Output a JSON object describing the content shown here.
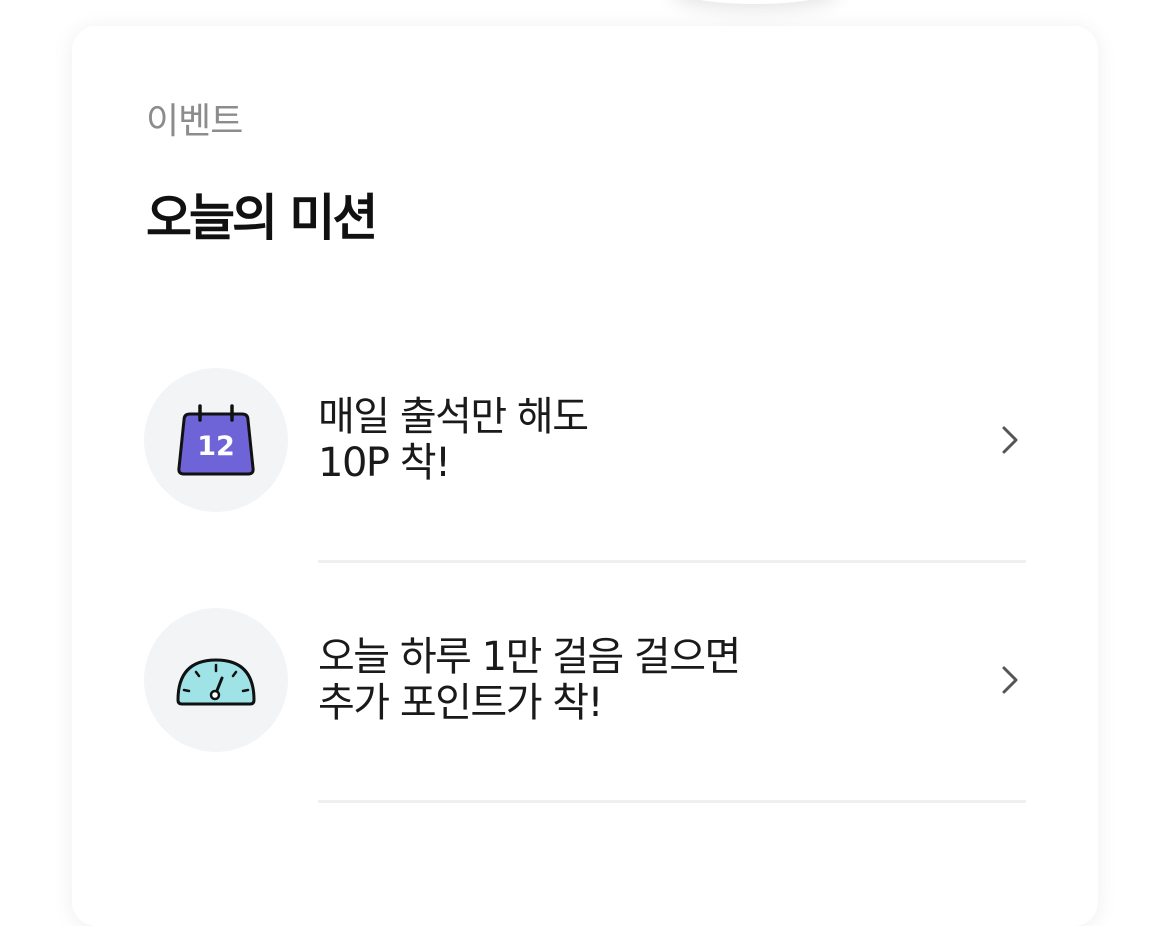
{
  "section": {
    "label": "이벤트",
    "title": "오늘의 미션"
  },
  "missions": [
    {
      "icon": "calendar-icon",
      "icon_text": "12",
      "line1": "매일 출석만 해도",
      "line2": "10P 착!"
    },
    {
      "icon": "speedometer-icon",
      "line1": "오늘 하루 1만 걸음 걸으면",
      "line2": "추가 포인트가 착!"
    }
  ],
  "colors": {
    "calendar_fill": "#6f63d8",
    "gauge_fill": "#9fe3e6",
    "icon_bg": "#f3f4f6",
    "label_gray": "#8c8c8c"
  }
}
